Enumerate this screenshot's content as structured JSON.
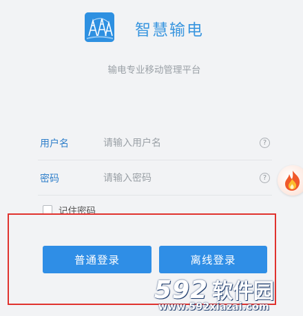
{
  "header": {
    "app_title": "智慧输电",
    "subtitle": "输电专业移动管理平台",
    "logo_icon": "transmission-tower-icon",
    "logo_color": "#2e90e1"
  },
  "form": {
    "username": {
      "label": "用户名",
      "placeholder": "请输入用户名",
      "help_icon": "question-circle-icon"
    },
    "password": {
      "label": "密码",
      "placeholder": "请输入密码",
      "help_icon": "question-circle-icon"
    },
    "remember": {
      "label": "记住密码",
      "checked": false
    },
    "help_glyph": "?"
  },
  "buttons": {
    "normal_login": "普通登录",
    "offline_login": "离线登录",
    "color": "#2f8ee6"
  },
  "overlay": {
    "avatar_icon": "flame-avatar-icon",
    "highlight_color": "#e0302c"
  },
  "watermark": {
    "number": "592",
    "text": "软件园",
    "url": "www.592xiazai.com"
  }
}
